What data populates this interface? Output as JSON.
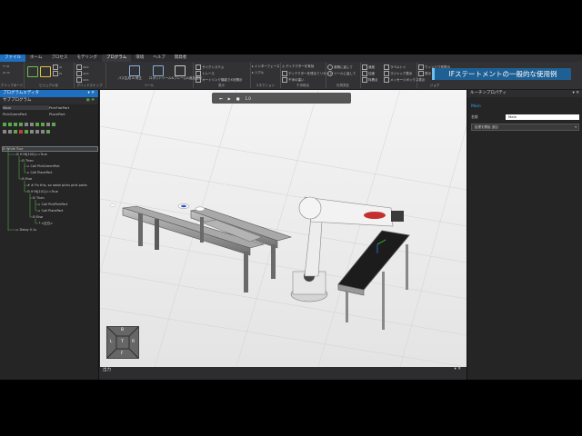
{
  "menu_tabs": [
    "ファイル",
    "ホーム",
    "プロセス",
    "モデリング",
    "プログラム",
    "環境",
    "ヘルプ",
    "開発者"
  ],
  "active_tab": "ファイル",
  "program_tab": "プログラム",
  "ribbon": {
    "groups": [
      "クリップボード",
      "ビジュアル化",
      "グリッドスナップ",
      "ツール",
      "表示",
      "コネクション",
      "干渉検出",
      "計測測定",
      "ジョグ"
    ],
    "items": {
      "show_grid": "サイクシステム",
      "trace": "トレース",
      "auto_align": "オートリンク機能でXを開示",
      "interference": "インターフェース",
      "exclude": "リアル",
      "detect": "ディテクターを有効",
      "detect_all": "ディテクターを残るてリセット",
      "freeze": "干渉の違い",
      "ref_display": "参照に返して",
      "tool_display": "ツールに返して",
      "speed": "速度",
      "accel": "加速",
      "simulation": "特異点",
      "ranges": "ラベルトイ",
      "wire": "ラジャック表示",
      "message": "メッセージボックス表示",
      "windows": "ウィンドウ別表示",
      "show": "表示"
    },
    "big_buttons": [
      "パス生成 & 修正",
      "ロボットツール&フレーム&追加登録",
      "座標"
    ]
  },
  "left_panel": {
    "title": "プログラムエディタ",
    "subprogram_title": "サブプログラム",
    "subprograms": [
      "Main",
      "PickFlatPart",
      "PickGreenPart",
      "PlacePart"
    ],
    "tree": [
      "While True",
      "If IN[100]==True",
      "Then",
      "Call PickGreenPart",
      "Call PlacePart",
      "Else",
      "# Fix this, so robot picks pink parts",
      "If IN[101]==True",
      "Then",
      "Call PickPinkPart",
      "Call PlacePart",
      "Else",
      "<空白>",
      "Delay 0.1s"
    ]
  },
  "view": {
    "nav_labels": {
      "top": "B",
      "left": "L",
      "center": "T",
      "right": "R",
      "bottom": "F"
    },
    "toolbar_value": "1.0"
  },
  "right_panel": {
    "title": "ルーチンプロパティ",
    "section": "Main",
    "name_label": "名前",
    "name_value": "Main",
    "dropdown": "処理を開始 追加"
  },
  "output": {
    "title": "出力"
  },
  "banner": "IFステートメントの一般的な使用例",
  "colors": {
    "accent": "#1e6fbf",
    "banner": "#1e5f94",
    "viewport": "#ececec"
  }
}
